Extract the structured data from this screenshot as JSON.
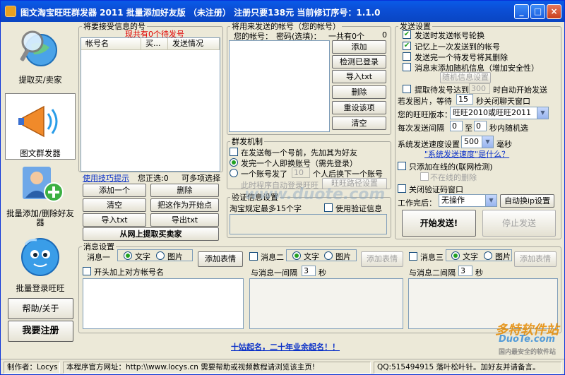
{
  "window": {
    "title": "图文淘宝旺旺群发器 2011 批量添加好友版 （未注册） 注册只要138元 当前修订序号：1.1.0",
    "min": "_",
    "max": "□",
    "close": "×"
  },
  "nav": {
    "items": [
      {
        "label": "提取买/卖家",
        "icon": "magnifier-globe-icon"
      },
      {
        "label": "图文群发器",
        "icon": "megaphone-icon"
      },
      {
        "label": "批量添加/删除好友器",
        "icon": "add-user-icon"
      },
      {
        "label": "批量登录旺旺",
        "icon": "wangwang-icon"
      }
    ],
    "help_label": "帮助/关于",
    "register_label": "我要注册"
  },
  "targets": {
    "legend": "将要接受信息的号",
    "count_text": "现共有0个待发号",
    "columns": [
      "帐号名",
      "买...",
      "发送情况"
    ],
    "tips_link": "使用技巧提示",
    "selected_text": "您正选:0",
    "multi_text": "可多项选择",
    "buttons": {
      "add_one": "添加一个",
      "delete": "删除",
      "clear": "清空",
      "set_start": "把这作为开始点",
      "import": "导入txt",
      "export": "导出txt",
      "fetch": "从网上提取买卖家"
    }
  },
  "senders": {
    "legend": "将用来发送的帐号（您的帐号）",
    "col_account": "您的帐号：",
    "col_password": "密码(选填)：",
    "total_text": "一共有0个",
    "total_num": "0",
    "buttons": [
      "添加",
      "检测已登录",
      "导入txt",
      "删除",
      "重设该项",
      "清空"
    ]
  },
  "mass": {
    "legend": "群发机制",
    "opt_add_friend": "在发送每一个号前，先加其为好友",
    "opt_one_person": "发完一个人即换账号（需先登录）",
    "opt_one_account_prefix": "一个账号发了",
    "opt_one_account_value": "10",
    "opt_one_account_suffix": "个人后换下一个账号",
    "auto_login_note": "此时程序自动登录旺旺",
    "wangwang_path_btn": "旺旺路径设置"
  },
  "verify": {
    "legend": "验证信息设置",
    "note": "淘宝规定最多15个字",
    "use_label": "使用验证信息"
  },
  "settings": {
    "legend": "发送设置",
    "rotate": "发送时发送帐号轮换",
    "remember": "记忆上一次发送到的帐号",
    "delete_after": "发送完一个待发号将其删除",
    "random_info": "消息末添加随机信息（增加安全性）",
    "random_btn": "随机信息设置",
    "fetch_prefix": "提取待发号达到",
    "fetch_value": "300",
    "fetch_suffix": "时自动开始发送",
    "image_prefix": "若发图片，等待",
    "image_value": "15",
    "image_suffix": "秒关闭聊天窗口",
    "version_label": "您的旺旺版本：",
    "version_value": "旺旺2010或旺旺2011",
    "interval_prefix": "每次发送间隔",
    "interval_from": "0",
    "interval_to_label": "至",
    "interval_to": "0",
    "interval_suffix": "秒内随机选",
    "speed_label": "系统发送速度设置",
    "speed_value": "500",
    "speed_unit": "毫秒",
    "speed_link": "\"系统发送速度\"是什么？",
    "online_only": "只添加在线的(联网检测)",
    "online_delete": "不在线的删除",
    "close_verify": "关闭验证码窗口",
    "after_label": "工作完后：",
    "after_value": "无操作",
    "auto_ip_btn": "自动换ip设置",
    "start_btn": "开始发送!",
    "stop_btn": "停止发送"
  },
  "messages": {
    "legend": "消息设置",
    "msg1": "消息一",
    "msg2": "消息二",
    "msg3": "消息三",
    "text": "文字",
    "image": "图片",
    "add_emoji": "添加表情",
    "prefix_name": "开头加上对方帐号名",
    "gap1": "与消息一间隔",
    "gap1_value": "3",
    "gap2": "与消息二间隔",
    "gap2_value": "3",
    "sec": "秒"
  },
  "slogan": "十姑起名，二十年业余起名！！",
  "status": {
    "author": "制作者：Locys",
    "site": "本程序官方网址：http:\\\\www.locys.cn 需要帮助或视频教程请浏览该主页!",
    "qq": "QQ:515494915 落叶松叶针。加好友并请备言。"
  },
  "watermarks": {
    "center": "www.duote.com",
    "brand": "多特软件站",
    "brand_url": "DuoTe.com",
    "brand_sub": "国内最安全的软件站"
  }
}
